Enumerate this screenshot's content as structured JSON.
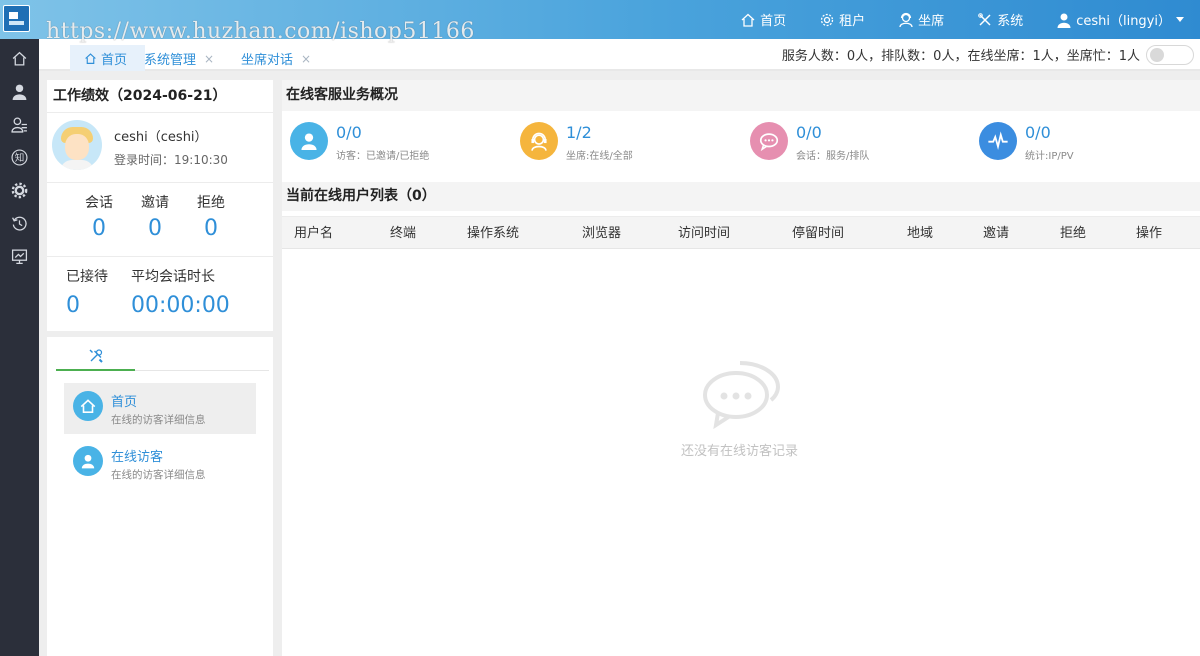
{
  "topbar": {
    "watermark": "https://www.huzhan.com/ishop51166",
    "nav": [
      {
        "label": "首页",
        "icon": "home-icon"
      },
      {
        "label": "租户",
        "icon": "gear-icon"
      },
      {
        "label": "坐席",
        "icon": "agent-icon"
      },
      {
        "label": "系统",
        "icon": "tools-icon"
      }
    ],
    "user": {
      "label": "ceshi（lingyi）",
      "icon": "user-icon"
    }
  },
  "rail": [
    "home-icon",
    "user-icon",
    "contacts-icon",
    "knowledge-icon",
    "gear-icon",
    "history-icon",
    "monitor-icon"
  ],
  "rail_knowledge_glyph": "知",
  "tabs": [
    {
      "label": "首页",
      "active": true
    },
    {
      "label": "系统管理",
      "active": false
    },
    {
      "label": "坐席对话",
      "active": false
    }
  ],
  "tab_close_glyph": "×",
  "status": {
    "text": "服务人数：0人，排队数：0人，在线坐席：1人，坐席忙：1人",
    "toggle_on": false
  },
  "performance": {
    "title": "工作绩效（2024-06-21）",
    "user_name": "ceshi（ceshi）",
    "login_label": "登录时间：",
    "login_time": "19:10:30",
    "sessions_label": "会话",
    "sessions": "0",
    "invites_label": "邀请",
    "invites": "0",
    "rejects_label": "拒绝",
    "rejects": "0",
    "received_label": "已接待",
    "received": "0",
    "avg_label": "平均会话时长",
    "avg": "00:00:00"
  },
  "tools": {
    "tab_icon": "tools-icon",
    "items": [
      {
        "title": "首页",
        "sub": "在线的访客详细信息",
        "icon": "home-icon"
      },
      {
        "title": "在线访客",
        "sub": "在线的访客详细信息",
        "icon": "user-icon"
      }
    ]
  },
  "overview": {
    "title": "在线客服业务概况",
    "cards": [
      {
        "value": "0/0",
        "label": "访客：已邀请/已拒绝",
        "icon": "visitor-icon",
        "color": "#49b3e6"
      },
      {
        "value": "1/2",
        "label": "坐席:在线/全部",
        "icon": "headset-icon",
        "color": "#f5b53d"
      },
      {
        "value": "0/0",
        "label": "会话：服务/排队",
        "icon": "chat-icon",
        "color": "#e68fb0"
      },
      {
        "value": "0/0",
        "label": "统计:IP/PV",
        "icon": "pulse-icon",
        "color": "#3b8de0"
      }
    ]
  },
  "online_list": {
    "title": "当前在线用户列表（0）",
    "columns": [
      "用户名",
      "终端",
      "操作系统",
      "浏览器",
      "访问时间",
      "停留时间",
      "地域",
      "邀请",
      "拒绝",
      "操作"
    ],
    "empty_text": "还没有在线访客记录"
  },
  "colors": {
    "accent": "#2f8fd8",
    "rail": "#2b2f3a",
    "tab_indicator": "#4caf50"
  }
}
